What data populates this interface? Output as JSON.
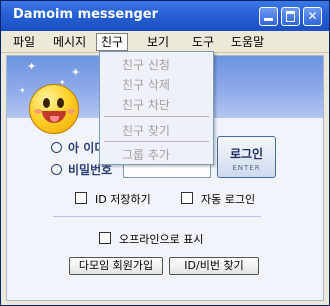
{
  "window": {
    "title": "Damoim messenger"
  },
  "menu": {
    "items": [
      "파일",
      "메시지",
      "친구",
      "보기",
      "도구",
      "도움말"
    ],
    "open_index": 2
  },
  "dropdown": {
    "items": [
      "친구 신청",
      "친구 삭제",
      "친구 차단",
      "친구 찾기",
      "그룹 추가"
    ],
    "enabled": false
  },
  "login": {
    "id_label": "아 이디",
    "password_label": "비밀번호",
    "login_button": "로그인",
    "login_button_sub": "ENTER",
    "save_id": "ID 저장하기",
    "auto_login": "자동 로그인",
    "offline_display": "오프라인으로 표시",
    "join_button": "다모임 회원가입",
    "find_button": "ID/비번 찾기"
  },
  "colors": {
    "titlebar": "#2762d6",
    "accent": "#2a3f7a"
  }
}
